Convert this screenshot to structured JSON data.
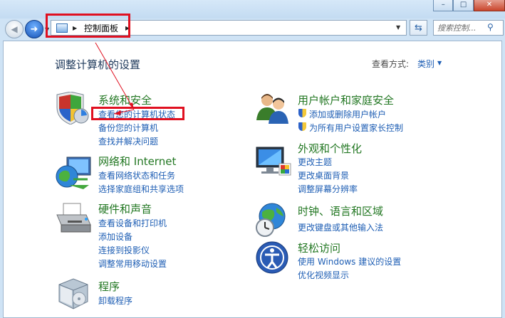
{
  "window": {
    "min_glyph": "–",
    "max_glyph": "□",
    "close_glyph": "✕"
  },
  "nav": {
    "back_glyph": "◀",
    "fwd_glyph": "➜",
    "breadcrumb": "控制面板",
    "search_placeholder": "搜索控制..."
  },
  "header": {
    "title": "调整计算机的设置",
    "view_by_label": "查看方式:",
    "view_by_value": "类别"
  },
  "categories": [
    {
      "title": "系统和安全",
      "links": [
        "查看您的计算机状态",
        "备份您的计算机",
        "查找并解决问题"
      ]
    },
    {
      "title": "网络和 Internet",
      "links": [
        "查看网络状态和任务",
        "选择家庭组和共享选项"
      ]
    },
    {
      "title": "硬件和声音",
      "links": [
        "查看设备和打印机",
        "添加设备",
        "连接到投影仪",
        "调整常用移动设置"
      ]
    },
    {
      "title": "程序",
      "links": [
        "卸载程序"
      ]
    },
    {
      "title": "用户帐户和家庭安全",
      "links": [
        "添加或删除用户帐户",
        "为所有用户设置家长控制"
      ]
    },
    {
      "title": "外观和个性化",
      "links": [
        "更改主题",
        "更改桌面背景",
        "调整屏幕分辨率"
      ]
    },
    {
      "title": "时钟、语言和区域",
      "links": [
        "更改键盘或其他输入法"
      ]
    },
    {
      "title": "轻松访问",
      "links": [
        "使用 Windows 建议的设置",
        "优化视频显示"
      ]
    }
  ],
  "icons": {
    "system_security": "shield-chart-icon",
    "network": "network-globe-icon",
    "hardware": "printer-icon",
    "programs": "program-box-icon",
    "user_accounts": "users-icon",
    "appearance": "monitor-paint-icon",
    "clock_language": "globe-clock-icon",
    "ease_of_access": "ease-of-access-icon"
  },
  "colors": {
    "category_title": "#227722",
    "link": "#1e5eb4",
    "highlight": "#e01020"
  }
}
